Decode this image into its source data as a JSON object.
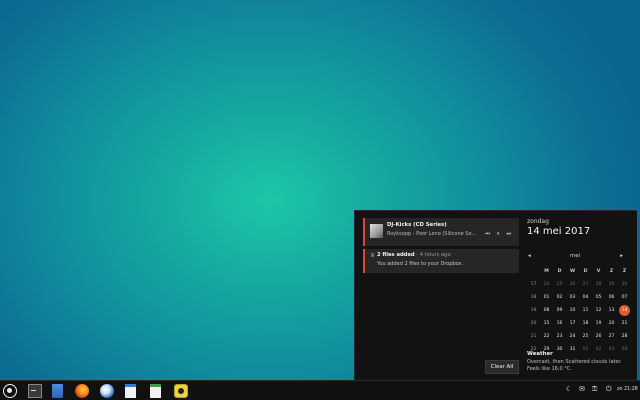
{
  "media": {
    "title": "DJ-Kicks (CD Series)",
    "subtitle": "Royksopp - Poor Leno (Silicone So...",
    "prev_icon": "⏮",
    "pause_icon": "⏸",
    "next_icon": "⏭"
  },
  "dropbox": {
    "title": "2 files added",
    "time": "- 4 hours ago",
    "body": "You added 2 files to your Dropbox.",
    "icon": "♕"
  },
  "clear_all_label": "Clear All",
  "calendar": {
    "day_name": "zondag",
    "date": "14 mei 2017",
    "month": "mei",
    "prev_icon": "◂",
    "next_icon": "▸",
    "headers": [
      "M",
      "D",
      "W",
      "D",
      "V",
      "Z",
      "Z"
    ],
    "weeks": [
      {
        "wk": "17",
        "days": [
          "24",
          "25",
          "26",
          "27",
          "28",
          "29",
          "30"
        ],
        "dim": [
          0,
          1,
          2,
          3,
          4,
          5,
          6
        ]
      },
      {
        "wk": "18",
        "days": [
          "01",
          "02",
          "03",
          "04",
          "05",
          "06",
          "07"
        ],
        "dim": []
      },
      {
        "wk": "19",
        "days": [
          "08",
          "09",
          "10",
          "11",
          "12",
          "13",
          "14"
        ],
        "dim": []
      },
      {
        "wk": "20",
        "days": [
          "15",
          "16",
          "17",
          "18",
          "19",
          "20",
          "21"
        ],
        "dim": []
      },
      {
        "wk": "21",
        "days": [
          "22",
          "23",
          "24",
          "25",
          "26",
          "27",
          "28"
        ],
        "dim": []
      },
      {
        "wk": "22",
        "days": [
          "29",
          "30",
          "31",
          "01",
          "02",
          "03",
          "04"
        ],
        "dim": [
          3,
          4,
          5,
          6
        ]
      }
    ],
    "today": "14"
  },
  "weather": {
    "title": "Weather",
    "text": "Overcast, then Scattered clouds later. Feels like 16,0 °C."
  },
  "taskbar": {
    "clock": "zo 21:28",
    "tray_icons": [
      "☾",
      "✉",
      "⚿",
      "⏻"
    ]
  },
  "colors": {
    "accent": "#d24a3c",
    "today": "#e05a2b",
    "panel_bg": "#121212"
  }
}
